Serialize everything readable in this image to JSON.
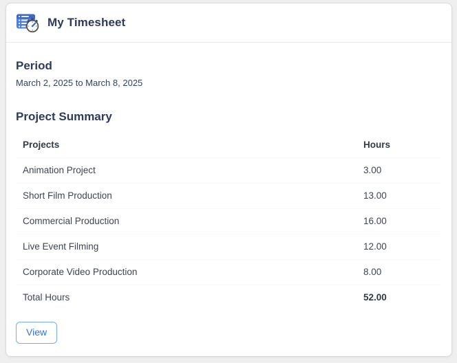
{
  "card": {
    "title": "My Timesheet",
    "period": {
      "heading": "Period",
      "range": "March 2, 2025 to March 8, 2025"
    },
    "summary": {
      "heading": "Project Summary",
      "columns": {
        "project": "Projects",
        "hours": "Hours"
      },
      "rows": [
        {
          "project": "Animation Project",
          "hours": "3.00"
        },
        {
          "project": "Short Film Production",
          "hours": "13.00"
        },
        {
          "project": "Commercial Production",
          "hours": "16.00"
        },
        {
          "project": "Live Event Filming",
          "hours": "12.00"
        },
        {
          "project": "Corporate Video Production",
          "hours": "8.00"
        }
      ],
      "total": {
        "label": "Total Hours",
        "value": "52.00"
      }
    },
    "view_button_label": "View"
  },
  "colors": {
    "page_background": "#efefef",
    "card_background": "#ffffff",
    "heading_navy": "#2e3a59",
    "table_text": "#3d4450",
    "accent_blue": "#2d71f0",
    "button_border": "#79aaf8",
    "icon_table_blue": "#4c7ee0",
    "icon_table_dark_blue": "#3e66c6",
    "total_divider": "#e0e0e0"
  }
}
